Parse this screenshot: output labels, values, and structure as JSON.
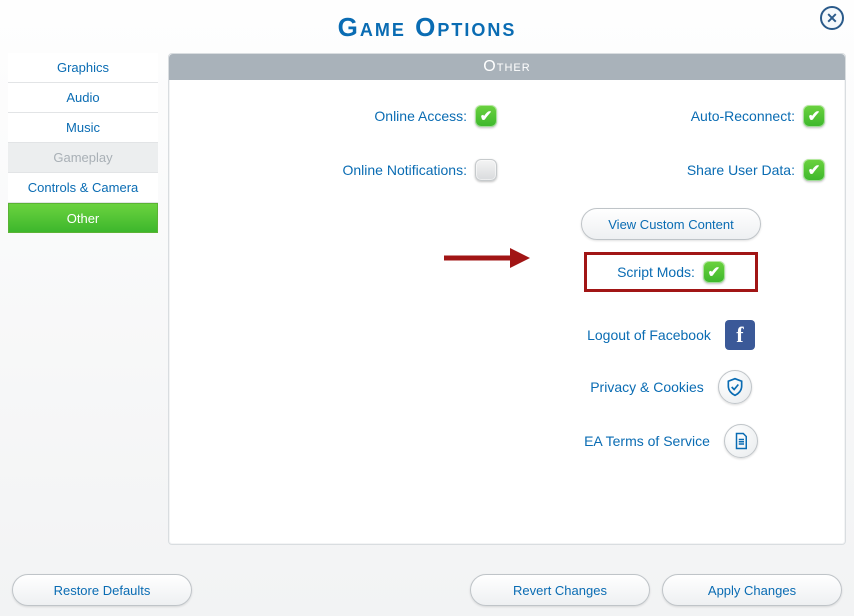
{
  "title": "Game Options",
  "panel_title": "Other",
  "sidebar": {
    "tabs": [
      {
        "label": "Graphics",
        "state": "normal"
      },
      {
        "label": "Audio",
        "state": "normal"
      },
      {
        "label": "Music",
        "state": "normal"
      },
      {
        "label": "Gameplay",
        "state": "disabled"
      },
      {
        "label": "Controls & Camera",
        "state": "normal"
      },
      {
        "label": "Other",
        "state": "active"
      }
    ]
  },
  "options": {
    "online_access": {
      "label": "Online Access:",
      "checked": true
    },
    "online_notifications": {
      "label": "Online Notifications:",
      "checked": false
    },
    "auto_reconnect": {
      "label": "Auto-Reconnect:",
      "checked": true
    },
    "share_user_data": {
      "label": "Share User Data:",
      "checked": true
    },
    "script_mods": {
      "label": "Script Mods:",
      "checked": true
    }
  },
  "buttons": {
    "view_custom_content": "View Custom Content",
    "restore_defaults": "Restore Defaults",
    "revert_changes": "Revert Changes",
    "apply_changes": "Apply Changes"
  },
  "links": {
    "logout_facebook": "Logout of Facebook",
    "privacy_cookies": "Privacy & Cookies",
    "ea_tos": "EA Terms of Service"
  },
  "annotation": {
    "highlight_target": "script_mods",
    "arrow_color": "#a11515"
  }
}
